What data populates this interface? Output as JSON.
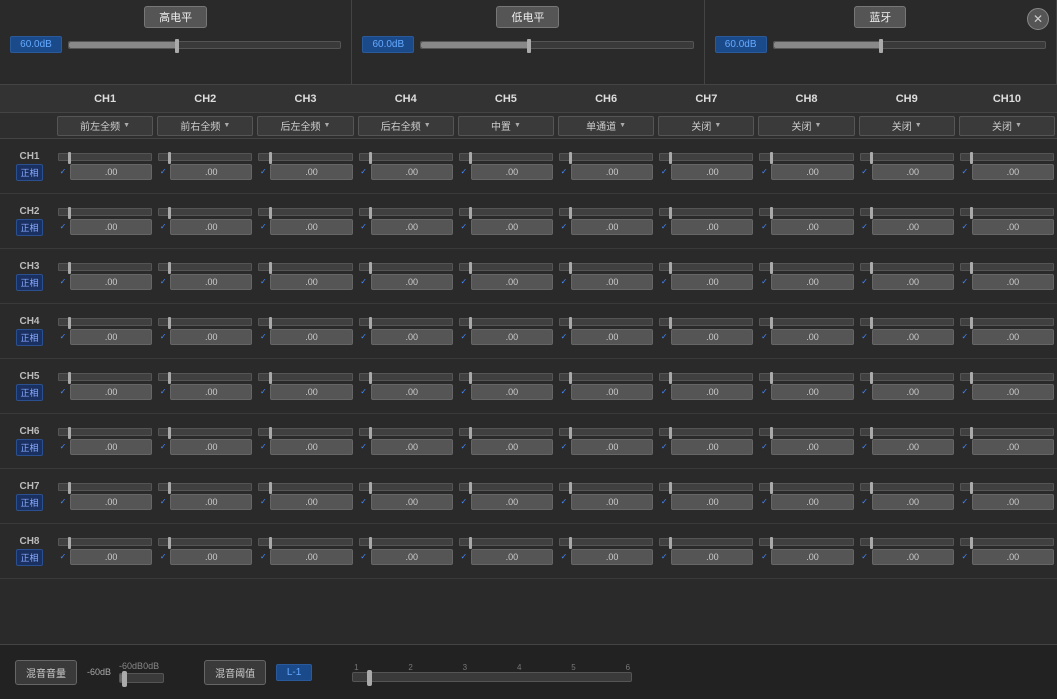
{
  "topPanels": [
    {
      "title": "高电平",
      "value": "60.0dB"
    },
    {
      "title": "低电平",
      "value": "60.0dB"
    },
    {
      "title": "蓝牙",
      "value": "60.0dB"
    }
  ],
  "channels": [
    "CH1",
    "CH2",
    "CH3",
    "CH4",
    "CH5",
    "CH6",
    "CH7",
    "CH8",
    "CH9",
    "CH10"
  ],
  "dropdowns": [
    "前左全频",
    "前右全频",
    "后左全频",
    "后右全频",
    "中置",
    "单通道",
    "关闭",
    "关闭",
    "关闭",
    "关闭"
  ],
  "rows": [
    {
      "ch": "CH1",
      "phase": "正相"
    },
    {
      "ch": "CH2",
      "phase": "正相"
    },
    {
      "ch": "CH3",
      "phase": "正相"
    },
    {
      "ch": "CH4",
      "phase": "正相"
    },
    {
      "ch": "CH5",
      "phase": "正相"
    },
    {
      "ch": "CH6",
      "phase": "正相"
    },
    {
      "ch": "CH7",
      "phase": "正相"
    },
    {
      "ch": "CH8",
      "phase": "正相"
    }
  ],
  "cellValue": ".00",
  "bottom": {
    "mixVolumeLabel": "混音音量",
    "mixThresholdLabel": "混音阈值",
    "volumeDb": "-60dB",
    "volumeSliderLabel": "-60dB",
    "tickMarks": [
      "-60dB",
      "",
      "0dB"
    ],
    "thresholdValue": "L-1",
    "thresholdTicks": [
      "1",
      "2",
      "3",
      "4",
      "5",
      "6"
    ]
  }
}
